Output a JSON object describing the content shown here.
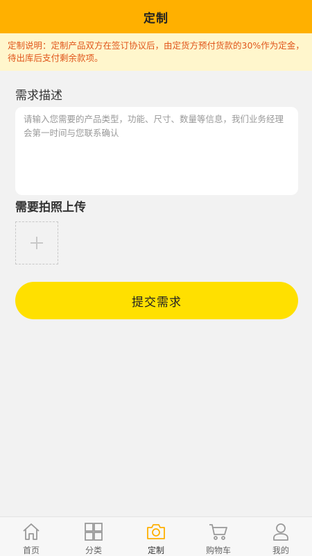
{
  "header": {
    "title": "定制"
  },
  "notice": {
    "text": "定制说明：定制产品双方在签订协议后，由定货方预付货款的30%作为定金，待出库后支付剩余款项。"
  },
  "form": {
    "description_label": "需求描述",
    "description_placeholder": "请输入您需要的产品类型，功能、尺寸、数量等信息，我们业务经理会第一时间与您联系确认",
    "description_value": "",
    "photo_label": "需要拍照上传",
    "submit_label": "提交需求"
  },
  "tabbar": {
    "active": "custom",
    "items": [
      {
        "key": "home",
        "label": "首页",
        "icon": "home-icon"
      },
      {
        "key": "category",
        "label": "分类",
        "icon": "category-grid-icon"
      },
      {
        "key": "custom",
        "label": "定制",
        "icon": "camera-icon"
      },
      {
        "key": "cart",
        "label": "购物车",
        "icon": "cart-icon"
      },
      {
        "key": "mine",
        "label": "我的",
        "icon": "user-icon"
      }
    ]
  },
  "colors": {
    "header_bg": "#ffb000",
    "notice_bg": "#fff6cc",
    "notice_text": "#e0561b",
    "submit_bg": "#ffe000",
    "active_icon": "#ffb000",
    "inactive_icon": "#999999"
  }
}
